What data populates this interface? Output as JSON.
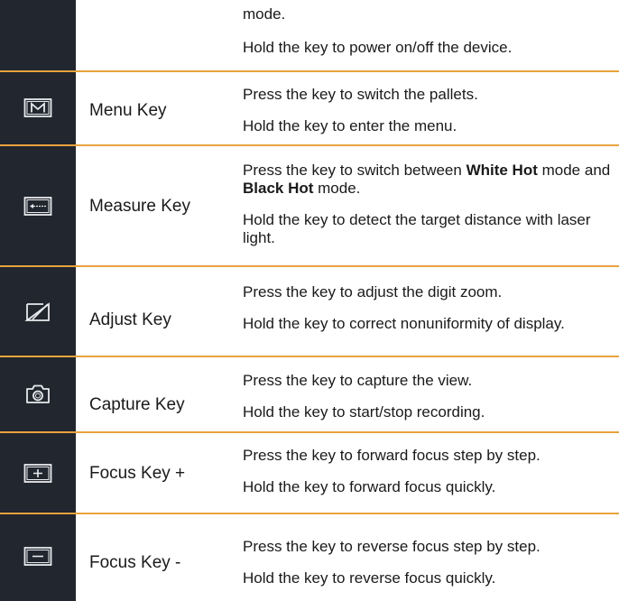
{
  "rows": [
    {
      "name": "",
      "icon": "",
      "descriptions": [
        {
          "text": "mode."
        },
        {
          "text": "Hold the key to power on/off the device."
        }
      ]
    },
    {
      "name": "Menu Key",
      "icon": "menu-key-icon",
      "descriptions": [
        {
          "text": "Press the key to switch the pallets."
        },
        {
          "text": "Hold the key to enter the menu."
        }
      ]
    },
    {
      "name": "Measure Key",
      "icon": "measure-key-icon",
      "descriptions": [
        {
          "before": "Press the key to switch between ",
          "bold1": "White Hot",
          "middle": " mode and ",
          "bold2": "Black Hot",
          "after": " mode."
        },
        {
          "text": "Hold the key to detect the target distance with laser light."
        }
      ]
    },
    {
      "name": "Adjust Key",
      "icon": "adjust-key-icon",
      "descriptions": [
        {
          "text": "Press the key to adjust the digit zoom."
        },
        {
          "text": "Hold the key to correct nonuniformity of display."
        }
      ]
    },
    {
      "name": "Capture Key",
      "icon": "camera-icon",
      "descriptions": [
        {
          "text": "Press the key to capture the view."
        },
        {
          "text": "Hold the key to start/stop recording."
        }
      ]
    },
    {
      "name": "Focus Key +",
      "icon": "plus-key-icon",
      "descriptions": [
        {
          "text": "Press the key to forward focus step by step."
        },
        {
          "text": "Hold the key to forward focus quickly."
        }
      ]
    },
    {
      "name": "Focus Key -",
      "icon": "minus-key-icon",
      "descriptions": [
        {
          "text": "Press the key to reverse focus step by step."
        },
        {
          "text": "Hold the key to reverse focus quickly."
        }
      ]
    }
  ],
  "colors": {
    "icon_column_bg": "#22262e",
    "divider": "#e8a33d",
    "icon_stroke": "#e8eaee"
  }
}
